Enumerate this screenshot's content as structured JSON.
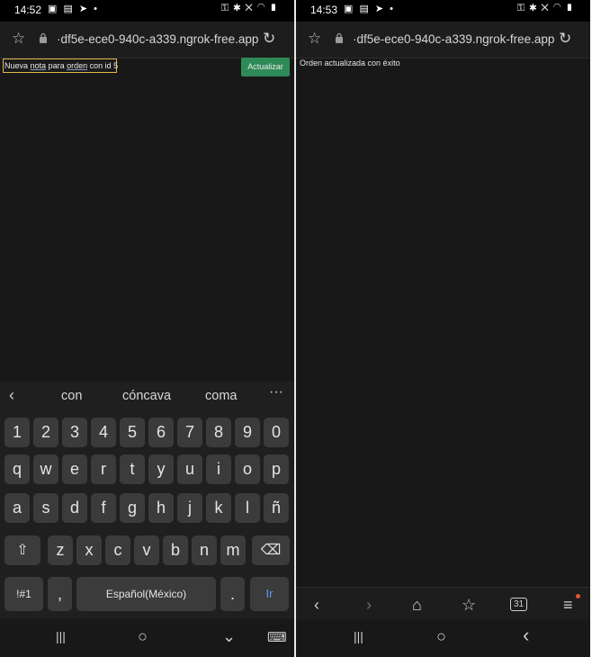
{
  "left": {
    "status": {
      "time": "14:52",
      "left_icons": "▣ ▤ ➤ •",
      "right_icons": "⚿ ✱ ✕ ◠ ▮"
    },
    "url": "·df5e-ece0-940c-a339.ngrok-free.app",
    "note_input": {
      "part1": "Nueva ",
      "part2": "nota",
      "part3": " para ",
      "part4": "orden",
      "part5": " con id 5"
    },
    "update_button": "Actualizar",
    "suggestions": {
      "back": "‹",
      "words": [
        "con",
        "cóncava",
        "coma"
      ],
      "more": "···"
    },
    "keyboard": {
      "row1": [
        "1",
        "2",
        "3",
        "4",
        "5",
        "6",
        "7",
        "8",
        "9",
        "0"
      ],
      "row2": [
        "q",
        "w",
        "e",
        "r",
        "t",
        "y",
        "u",
        "i",
        "o",
        "p"
      ],
      "row3": [
        "a",
        "s",
        "d",
        "f",
        "g",
        "h",
        "j",
        "k",
        "l",
        "ñ"
      ],
      "row4": [
        "z",
        "x",
        "c",
        "v",
        "b",
        "n",
        "m"
      ],
      "shift": "⇧",
      "backspace": "⌫",
      "symbols": "!#1",
      "comma": ",",
      "space": "Español(México)",
      "period": ".",
      "go": "Ir"
    },
    "sysnav": {
      "recent": "|||",
      "home": "○",
      "back": "⌄",
      "keyboard": "⌨"
    }
  },
  "right": {
    "status": {
      "time": "14:53",
      "left_icons": "▣ ▤ ➤ •",
      "right_icons": "⚿ ✱ ✕ ◠ ▮"
    },
    "url": "·df5e-ece0-940c-a339.ngrok-free.app",
    "success_message": "Orden actualizada con éxito",
    "browsernav": {
      "back": "‹",
      "forward": "›",
      "home": "⌂",
      "bookmarks": "☆",
      "tabs_count": "31",
      "menu": "≡"
    },
    "sysnav": {
      "recent": "|||",
      "home": "○",
      "back": "‹"
    }
  },
  "colors": {
    "update_button_bg": "#2e8b57",
    "input_border": "#e1b74a",
    "go_key": "#5aa0f0",
    "badge": "#e2533a"
  }
}
